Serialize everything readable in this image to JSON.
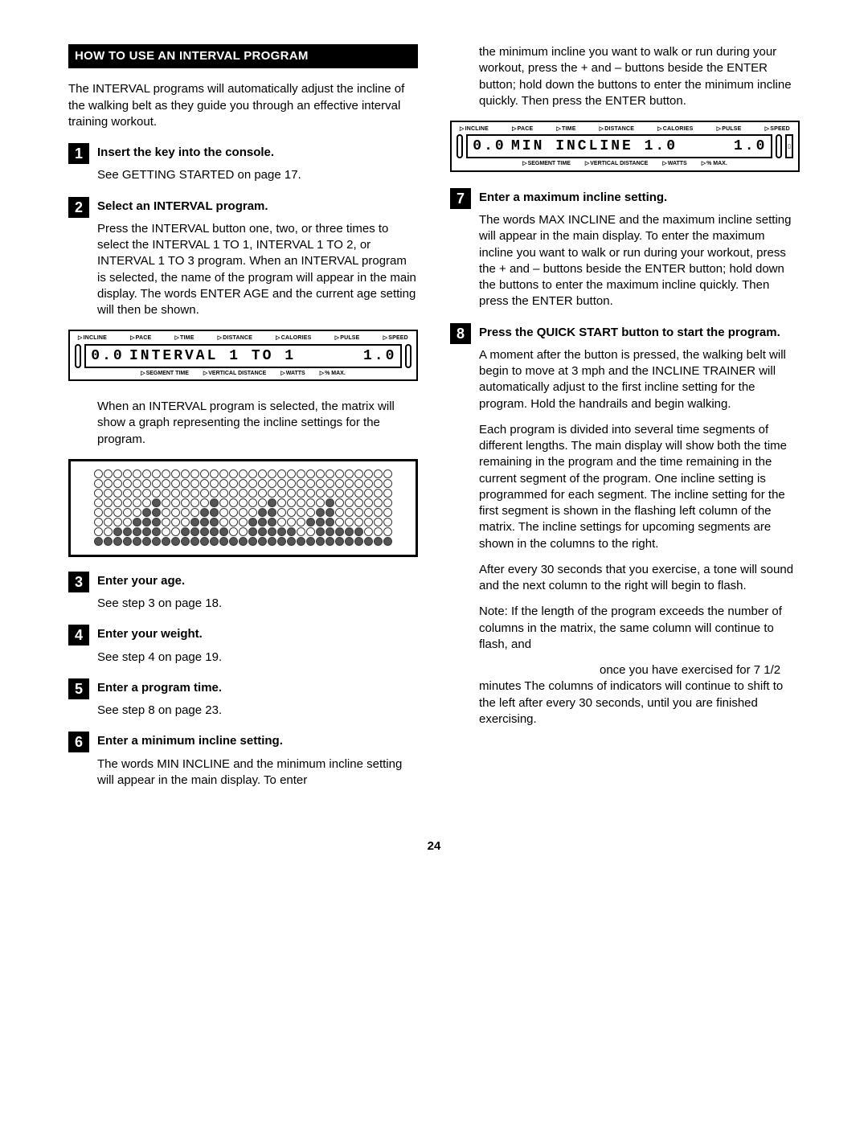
{
  "pageNumber": "24",
  "sectionTitle": "HOW TO USE AN INTERVAL PROGRAM",
  "intro": "The INTERVAL programs will automatically adjust the incline of the walking belt as they guide you through an effective interval training workout.",
  "steps": {
    "s1": {
      "num": "1",
      "title": "Insert the key into the console.",
      "body": "See GETTING STARTED on page 17."
    },
    "s2": {
      "num": "2",
      "title": "Select an INTERVAL program.",
      "body": "Press the INTERVAL button one, two, or three times to select the INTERVAL 1 TO 1, INTERVAL 1 TO 2, or INTERVAL 1 TO 3 program. When an INTERVAL program is selected, the name of the program will appear in the main display. The words ENTER AGE and the current age setting will then be shown."
    },
    "s2b": "When an INTERVAL program is selected, the matrix will show a graph representing the incline settings for the program.",
    "s3": {
      "num": "3",
      "title": "Enter your age.",
      "body": "See step 3 on page 18."
    },
    "s4": {
      "num": "4",
      "title": "Enter your weight.",
      "body": "See step 4 on page 19."
    },
    "s5": {
      "num": "5",
      "title": "Enter a program time.",
      "body": "See step 8 on page 23."
    },
    "s6": {
      "num": "6",
      "title": "Enter a minimum incline setting.",
      "body": "The words MIN INCLINE and the minimum incline setting will appear in the main display. To enter"
    },
    "s6cont": "the minimum incline you want to walk or run during your workout, press the + and – buttons beside the ENTER button; hold down the buttons to enter the minimum incline quickly. Then press the ENTER button.",
    "s7": {
      "num": "7",
      "title": "Enter a maximum incline setting.",
      "body": "The words MAX INCLINE and the maximum incline setting will appear in the main display. To enter the maximum incline you want to walk or run during your workout, press the + and – buttons beside the ENTER button; hold down the buttons to enter the maximum incline quickly. Then press the ENTER button."
    },
    "s8": {
      "num": "8",
      "title": "Press the QUICK START button to start the program.",
      "b1": "A moment after the button is pressed, the walking belt will begin to move at 3 mph and the INCLINE TRAINER will automatically adjust to the first incline setting for the program. Hold the handrails and begin walking.",
      "b2": "Each program is divided into several time segments of different lengths. The main display will show both the time remaining in the program and the time remaining in the current segment of the program. One incline setting is programmed for each segment. The incline setting for the first segment is shown in the flashing left column of the matrix. The incline settings for upcoming segments are shown in the columns to the right.",
      "b3": "After every 30 seconds that you exercise, a tone will sound and the next column to the right will begin to flash.",
      "b4a": "Note: If the length of the program exceeds the number of columns in the matrix, the same column will continue to flash, and",
      "b4b": "once you have exercised for 7 1/2 minutes  The columns of indicators will continue to shift to the left after every 30 seconds, until you are finished exercising."
    }
  },
  "lcd": {
    "topLabels": [
      "INCLINE",
      "PACE",
      "TIME",
      "DISTANCE",
      "CALORIES",
      "PULSE",
      "SPEED"
    ],
    "bottomLabels": [
      "SEGMENT TIME",
      "VERTICAL DISTANCE",
      "WATTS",
      "% MAX."
    ],
    "d1": {
      "left": "0.0",
      "center": "INTERVAL  1 TO  1",
      "right": "1.0"
    },
    "d2": {
      "left": "0.0",
      "center": "MIN INCLINE  1.0",
      "right": "1.0"
    }
  },
  "matrixRows": [
    "0000000000000000000000000000000",
    "0000000000000000000000000000000",
    "0000000000000000000000000000000",
    "0000001000001000001000001000000",
    "0000011000011000011000011000000",
    "0000111000111000111000111000000",
    "0011111001111100111110011111000",
    "1111111111111111111111111111111"
  ]
}
